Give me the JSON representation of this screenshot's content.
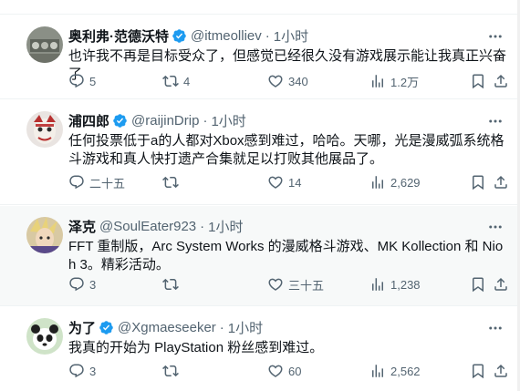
{
  "colors": {
    "accent": "#1d9bf0",
    "muted": "#536471",
    "text": "#0f1419",
    "border": "#eff3f4"
  },
  "tweets": [
    {
      "name": "奥利弗·范德沃特",
      "verified": true,
      "handle": "@itmeolliev",
      "dot": "·",
      "time": "1小时",
      "text": "也许我不再是目标受众了，但感觉已经很久没有游戏展示能让我真正兴奋了",
      "replies": "5",
      "retweets": "4",
      "likes": "340",
      "views": "1.2万"
    },
    {
      "name": "浦四郎",
      "verified": true,
      "handle": "@raijinDrip",
      "dot": "·",
      "time": "1小时",
      "text": "任何投票低于a的人都对Xbox感到难过，哈哈。天哪，光是漫威弧系统格斗游戏和真人快打遗产合集就足以打败其他展品了。",
      "replies": "二十五",
      "retweets": "",
      "likes": "14",
      "views": "2,629"
    },
    {
      "name": "泽克",
      "verified": false,
      "handle": "@SoulEater923",
      "dot": "·",
      "time": "1小时",
      "text": "FFT 重制版，Arc System Works 的漫威格斗游戏、MK Kollection 和 Nioh 3。精彩活动。",
      "replies": "3",
      "retweets": "",
      "likes": "三十五",
      "views": "1,238"
    },
    {
      "name": "为了",
      "verified": true,
      "handle": "@Xgmaeseeker",
      "dot": "·",
      "time": "1小时",
      "text": "我真的开始为 PlayStation 粉丝感到难过。",
      "replies": "3",
      "retweets": "",
      "likes": "60",
      "views": "2,562"
    }
  ]
}
